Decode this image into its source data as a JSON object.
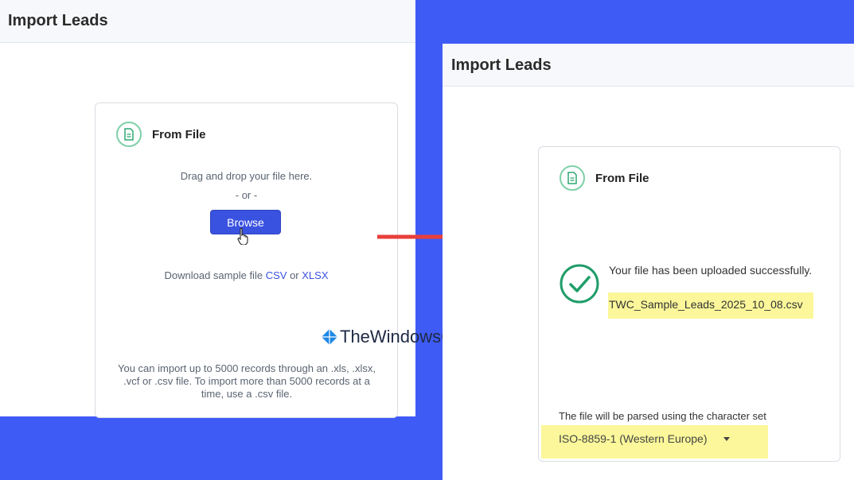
{
  "left": {
    "header_title": "Import Leads",
    "card_title": "From File",
    "drag_text": "Drag and drop your file here.",
    "or_text": "- or -",
    "browse_label": "Browse",
    "download_prefix": "Download sample file",
    "csv_link": "CSV",
    "or_word": "or",
    "xlsx_link": "XLSX",
    "note": "You can import up to 5000 records through an .xls, .xlsx, .vcf or .csv file. To import more than 5000 records at a time, use a .csv file."
  },
  "right": {
    "header_title": "Import Leads",
    "card_title": "From File",
    "uploaded_text": "Your file has been uploaded successfully.",
    "filename": "TWC_Sample_Leads_2025_10_08.csv",
    "charset_label": "The file will be parsed using the character set",
    "charset_value": "ISO-8859-1 (Western Europe)"
  },
  "watermark": "TheWindowsClub.com",
  "colors": {
    "background": "#3f5bf6",
    "accent": "#3a52e0",
    "arrow": "#e8403b",
    "highlight": "#fbf79a",
    "success": "#1f9d6a"
  }
}
